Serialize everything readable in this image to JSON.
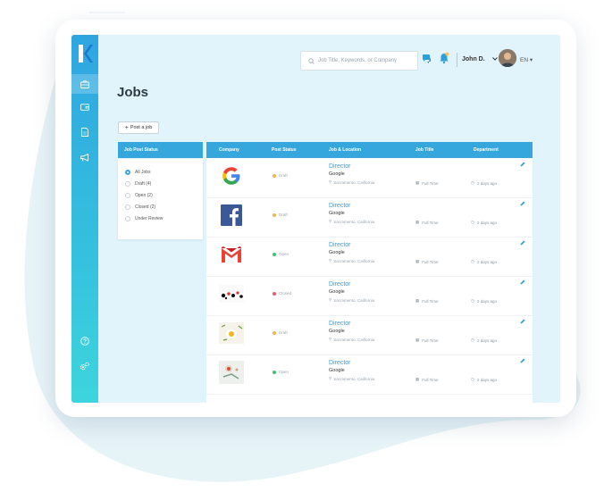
{
  "header": {
    "search_placeholder": "Job Title, Keywords, or Company",
    "user_name": "John D.",
    "language": "EN"
  },
  "page": {
    "title": "Jobs",
    "post_job_label": "Post a job"
  },
  "filters": {
    "heading": "Job Post Status",
    "items": [
      {
        "label": "All Jobs",
        "checked": true
      },
      {
        "label": "Draft (4)",
        "checked": false
      },
      {
        "label": "Open (2)",
        "checked": false
      },
      {
        "label": "Closed (2)",
        "checked": false
      },
      {
        "label": "Under Review",
        "checked": false
      }
    ]
  },
  "table": {
    "columns": [
      "Company",
      "Post Status",
      "Job & Location",
      "Job Title",
      "Department"
    ],
    "rows": [
      {
        "logo": "google-logo",
        "status": "Draft",
        "status_color": "#f5b54a",
        "title": "Director",
        "company": "Google",
        "location": "Sacramento, California",
        "job_type": "Full Time",
        "posted": "2 days ago"
      },
      {
        "logo": "facebook-logo",
        "status": "Draft",
        "status_color": "#f5b54a",
        "title": "Director",
        "company": "Google",
        "location": "Sacramento, California",
        "job_type": "Full Time",
        "posted": "2 days ago"
      },
      {
        "logo": "gmail-logo",
        "status": "Open",
        "status_color": "#3cc66a",
        "title": "Director",
        "company": "Google",
        "location": "Sacramento, California",
        "job_type": "Full Time",
        "posted": "2 days ago"
      },
      {
        "logo": "abstract-logo",
        "status": "Closed",
        "status_color": "#ec5b6a",
        "title": "Director",
        "company": "Google",
        "location": "Sacramento, California",
        "job_type": "Full Time",
        "posted": "2 days ago"
      },
      {
        "logo": "egg-logo",
        "status": "Draft",
        "status_color": "#f5b54a",
        "title": "Director",
        "company": "Google",
        "location": "Sacramento, California",
        "job_type": "Full Time",
        "posted": "2 days ago"
      },
      {
        "logo": "art-logo",
        "status": "Open",
        "status_color": "#3cc66a",
        "title": "Director",
        "company": "Google",
        "location": "Sacramento, California",
        "job_type": "Full Time",
        "posted": "2 days ago"
      }
    ]
  },
  "colors": {
    "accent": "#36a7dd",
    "screen_bg": "#e1f4fb",
    "link": "#2fa0db"
  },
  "icons": {
    "sidebar": [
      "briefcase-icon",
      "wallet-icon",
      "document-icon",
      "megaphone-icon",
      "help-icon",
      "settings-icon"
    ],
    "topbar": [
      "search-icon",
      "chat-icon",
      "bell-icon",
      "chevron-down-icon"
    ]
  }
}
